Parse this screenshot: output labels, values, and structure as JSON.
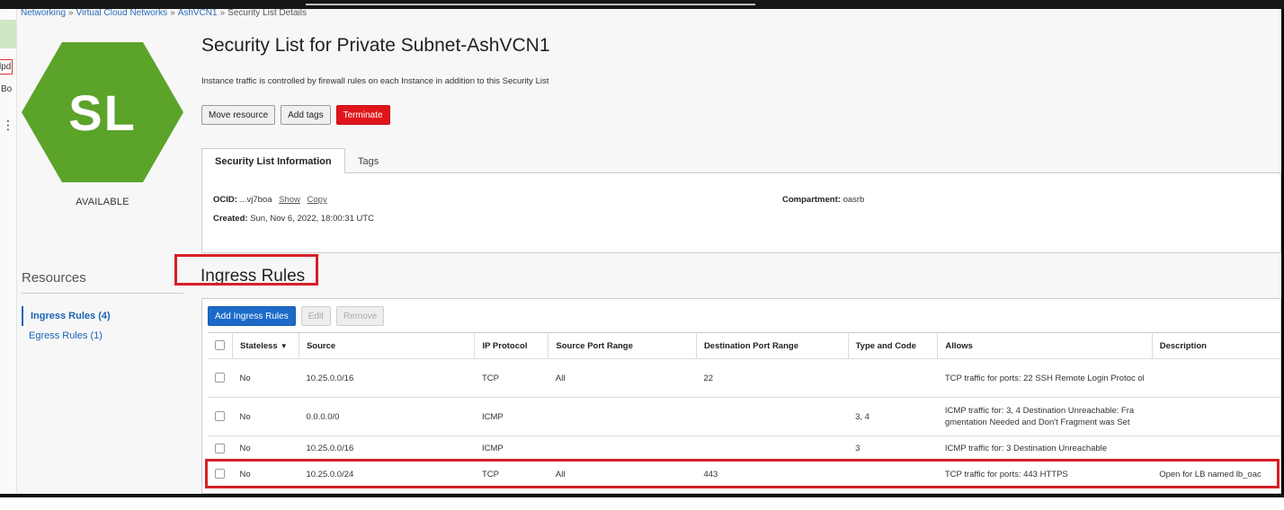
{
  "edge": {
    "fragment_top": "lpd",
    "fragment_mid": "Bo",
    "fragment_dots": "⋮"
  },
  "breadcrumb": {
    "items": [
      "Networking",
      "Virtual Cloud Networks",
      "AshVCN1",
      "Security List Details"
    ],
    "separator": "»"
  },
  "resource": {
    "badge": "SL",
    "badge_color": "#5ca32a",
    "status": "AVAILABLE",
    "title": "Security List for Private Subnet-AshVCN1",
    "description": "Instance traffic is controlled by firewall rules on each Instance in addition to this Security List"
  },
  "actions": {
    "move": "Move resource",
    "tags": "Add tags",
    "terminate": "Terminate"
  },
  "tabs": {
    "info": "Security List Information",
    "tags": "Tags"
  },
  "info": {
    "ocid_label": "OCID:",
    "ocid_value": "...vj7boa",
    "show": "Show",
    "copy": "Copy",
    "created_label": "Created:",
    "created_value": "Sun, Nov 6, 2022, 18:00:31 UTC",
    "compartment_label": "Compartment:",
    "compartment_value": "oasrb"
  },
  "resources": {
    "title": "Resources",
    "items": [
      {
        "label": "Ingress Rules (4)",
        "active": true
      },
      {
        "label": "Egress Rules (1)",
        "active": false
      }
    ]
  },
  "ingress": {
    "title": "Ingress Rules",
    "add_button": "Add Ingress Rules",
    "edit_button": "Edit",
    "remove_button": "Remove",
    "columns": [
      "Stateless",
      "Source",
      "IP Protocol",
      "Source Port Range",
      "Destination Port Range",
      "Type and Code",
      "Allows",
      "Description"
    ],
    "sort_icon": "▼",
    "rows": [
      {
        "stateless": "No",
        "source": "10.25.0.0/16",
        "protocol": "TCP",
        "src_port": "All",
        "dst_port": "22",
        "type_code": "",
        "allows": "TCP traffic for ports: 22 SSH Remote Login Protoc ol",
        "description": ""
      },
      {
        "stateless": "No",
        "source": "0.0.0.0/0",
        "protocol": "ICMP",
        "src_port": "",
        "dst_port": "",
        "type_code": "3, 4",
        "allows": "ICMP traffic for: 3, 4 Destination Unreachable: Fra gmentation Needed and Don't Fragment was Set",
        "description": ""
      },
      {
        "stateless": "No",
        "source": "10.25.0.0/16",
        "protocol": "ICMP",
        "src_port": "",
        "dst_port": "",
        "type_code": "3",
        "allows": "ICMP traffic for: 3 Destination Unreachable",
        "description": ""
      },
      {
        "stateless": "No",
        "source": "10.25.0.0/24",
        "protocol": "TCP",
        "src_port": "All",
        "dst_port": "443",
        "type_code": "",
        "allows": "TCP traffic for ports: 443 HTTPS",
        "description": "Open for LB named lb_oac"
      }
    ]
  },
  "colors": {
    "link": "#1a64b4",
    "primary": "#1b6ac9",
    "danger": "#e0151b",
    "highlight": "#d62027"
  }
}
